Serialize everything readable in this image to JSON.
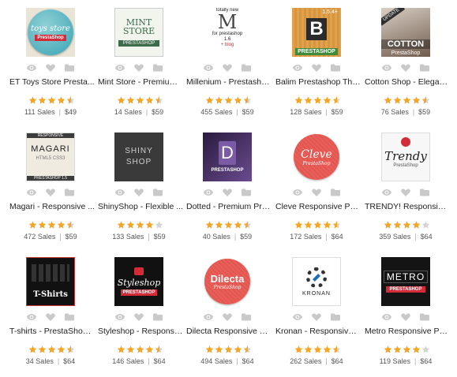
{
  "products": [
    {
      "title": "ET Toys Store Presta...",
      "sales": "111 Sales",
      "price": "$49",
      "rating": 4.5,
      "thumb_text": "toys store",
      "thumb_sub": "PrestaShop"
    },
    {
      "title": "Mint Store - Premium ...",
      "sales": "14 Sales",
      "price": "$59",
      "rating": 4.5,
      "thumb_text": "MINT STORE",
      "thumb_sub": "PRESTASHOP"
    },
    {
      "title": "Millenium - Prestasho...",
      "sales": "455 Sales",
      "price": "$59",
      "rating": 4.5,
      "thumb_text": "M",
      "thumb_top": "totally new",
      "thumb_sub": "for prestashop 1.6",
      "thumb_extra": "+ blog"
    },
    {
      "title": "Balim Prestashop The...",
      "sales": "128 Sales",
      "price": "$59",
      "rating": 4.5,
      "thumb_text": "B",
      "thumb_top": "1.5.4+",
      "thumb_sub": "PRESTASHOP"
    },
    {
      "title": "Cotton Shop - Elegant ...",
      "sales": "76 Sales",
      "price": "$59",
      "rating": 4.5,
      "thumb_text": "COTTON",
      "thumb_top": "UPDATE",
      "thumb_sub": "PrestaShop"
    },
    {
      "title": "Magari - Responsive ...",
      "sales": "472 Sales",
      "price": "$59",
      "rating": 4.5,
      "thumb_text": "MAGARI",
      "thumb_top": "RESPONSIVE",
      "thumb_sub": "HTML5  CSS3",
      "thumb_extra": "PRESTASHOP 1.5"
    },
    {
      "title": "ShinyShop - Flexible ...",
      "sales": "133 Sales",
      "price": "$59",
      "rating": 4,
      "thumb_text": "SHINY SHOP"
    },
    {
      "title": "Dotted - Premium Pre...",
      "sales": "40 Sales",
      "price": "$59",
      "rating": 4.5,
      "thumb_text": "D",
      "thumb_sub": "PRESTASHOP"
    },
    {
      "title": "Cleve Responsive Pre...",
      "sales": "172 Sales",
      "price": "$64",
      "rating": 4.5,
      "thumb_text": "Cleve",
      "thumb_sub": "PrestaShop"
    },
    {
      "title": "TRENDY! Responsive ...",
      "sales": "359 Sales",
      "price": "$64",
      "rating": 4,
      "thumb_text": "Trendy",
      "thumb_sub": "PrestaShop"
    },
    {
      "title": "T-shirts - PrestaShop ...",
      "sales": "34 Sales",
      "price": "$64",
      "rating": 4.5,
      "thumb_text": "T-Shirts"
    },
    {
      "title": "Styleshop - Responsiv...",
      "sales": "146 Sales",
      "price": "$64",
      "rating": 4.5,
      "thumb_text": "Styleshop",
      "thumb_sub": "PRESTASHOP"
    },
    {
      "title": "Dilecta Responsive Pr...",
      "sales": "494 Sales",
      "price": "$64",
      "rating": 4.5,
      "thumb_text": "Dilecta",
      "thumb_sub": "PrestaShop"
    },
    {
      "title": "Kronan - Responsive ...",
      "sales": "262 Sales",
      "price": "$64",
      "rating": 4.5,
      "thumb_text": "KRONAN"
    },
    {
      "title": "Metro Responsive Pre...",
      "sales": "119 Sales",
      "price": "$64",
      "rating": 4,
      "thumb_text": "METRO",
      "thumb_sub": "PRESTASHOP"
    }
  ],
  "icons": {
    "preview": "eye-icon",
    "like": "heart-icon",
    "collection": "folder-icon"
  },
  "colors": {
    "star": "#f5a623",
    "star_empty": "#d4d4d4",
    "icon": "#c9c9c9",
    "prestashop_red": "#d42b38"
  }
}
